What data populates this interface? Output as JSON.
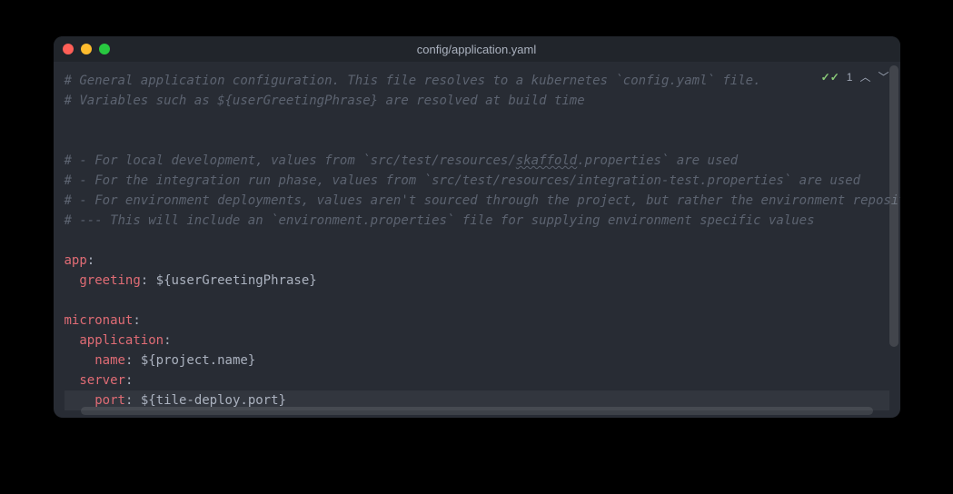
{
  "window": {
    "title": "config/application.yaml"
  },
  "overlay": {
    "issues_count": "1"
  },
  "code": {
    "c1": "# General application configuration. This file resolves to a kubernetes `config.yaml` file.",
    "c2": "# Variables such as ${userGreetingPhrase} are resolved at build time",
    "c3a": "# - For local development, values from `src/test/resources/",
    "c3_spell": "skaffold",
    "c3b": ".properties` are used",
    "c4": "# - For the integration run phase, values from `src/test/resources/integration-test.properties` are used",
    "c5": "# - For environment deployments, values aren't sourced through the project, but rather the environment repository",
    "c6": "# --- This will include an `environment.properties` file for supplying environment specific values",
    "k_app": "app",
    "k_greeting": "greeting",
    "v_greeting": "${userGreetingPhrase}",
    "k_micronaut": "micronaut",
    "k_application": "application",
    "k_name": "name",
    "v_name": "${project.name}",
    "k_server": "server",
    "k_port": "port",
    "v_port": "${tile-deploy.port}",
    "colon": ":"
  }
}
